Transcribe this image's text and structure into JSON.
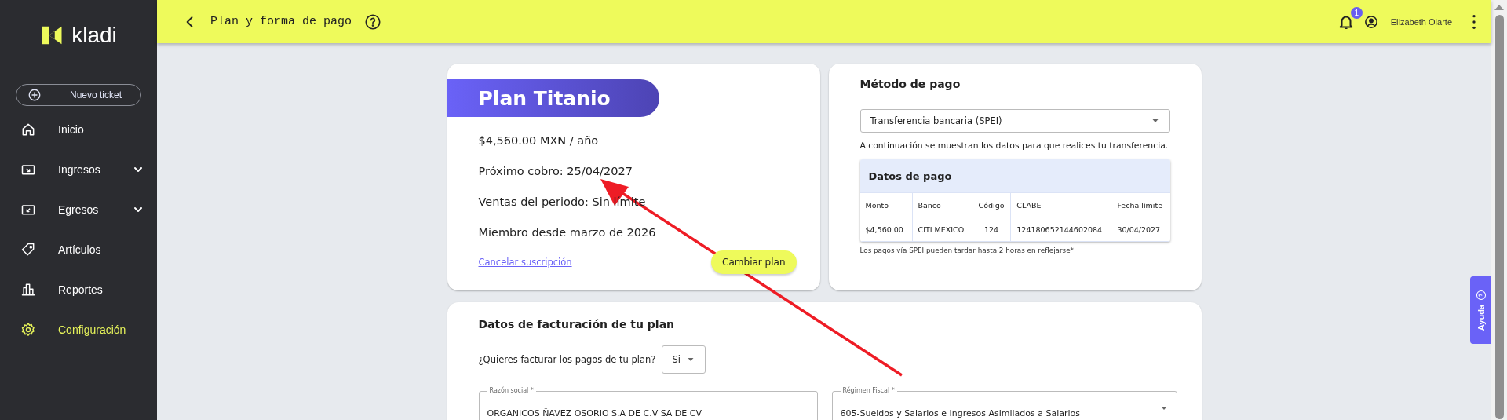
{
  "sidebar": {
    "logo": "kladi",
    "new_ticket": "Nuevo ticket",
    "items": [
      {
        "label": "Inicio",
        "kind": "link",
        "selected": false
      },
      {
        "label": "Ingresos",
        "kind": "group",
        "selected": false
      },
      {
        "label": "Egresos",
        "kind": "group",
        "selected": false
      },
      {
        "label": "Artículos",
        "kind": "link",
        "selected": false
      },
      {
        "label": "Reportes",
        "kind": "link",
        "selected": false
      },
      {
        "label": "Configuración",
        "kind": "link",
        "selected": true
      }
    ]
  },
  "header": {
    "title": "Plan y forma de pago",
    "notification_count": "1",
    "user_name": "Elizabeth Olarte"
  },
  "plan": {
    "title": "Plan Titanio",
    "lines": [
      "$4,560.00 MXN / año",
      "Próximo cobro: 25/04/2027",
      "Ventas del periodo: Sin límite",
      "Miembro desde marzo de 2026"
    ],
    "cancel_link": "Cancelar suscripción",
    "change_button": "Cambiar plan"
  },
  "payment": {
    "title": "Método de pago",
    "method": "Transferencia bancaria (SPEI)",
    "description": "A continuación se muestran los datos para que realices tu transferencia.",
    "table": {
      "title": "Datos de pago",
      "columns": [
        "Monto",
        "Banco",
        "Código",
        "CLABE",
        "Fecha límite"
      ],
      "rows": [
        [
          "$4,560.00",
          "CITI MEXICO",
          "124",
          "124180652144602084",
          "30/04/2027"
        ]
      ]
    },
    "note": "Los pagos vía SPEI pueden tardar hasta 2 horas en reflejarse*"
  },
  "billing": {
    "title": "Datos de facturación de tu plan",
    "question": "¿Quieres facturar los pagos de tu plan?",
    "invoice_choice": "Si",
    "fields": [
      {
        "label": "Razón social *",
        "value": "ORGANICOS ÑAVEZ OSORIO S.A DE C.V SA DE CV",
        "kind": "text"
      },
      {
        "label": "Régimen Fiscal *",
        "value": "605-Sueldos y Salarios e Ingresos Asimilados a Salarios",
        "kind": "select"
      }
    ]
  },
  "help_tab": "Ayuda"
}
